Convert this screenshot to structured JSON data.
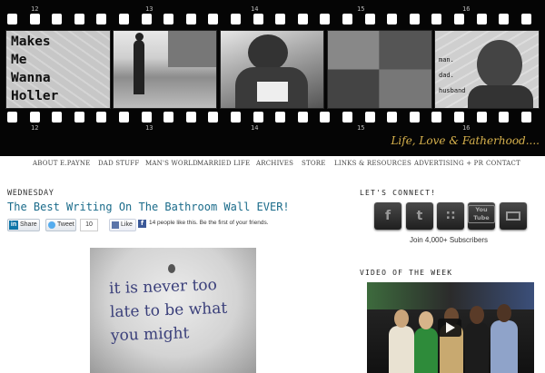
{
  "header": {
    "blog_title": "Makes\nMe\nWanna\nHoller",
    "frame_numbers": [
      "12",
      "13",
      "14",
      "15",
      "16"
    ],
    "tagline_words": [
      "man.",
      "dad.",
      "husband"
    ],
    "slogan": "Life, Love & Fatherhood...."
  },
  "nav": {
    "items": [
      "ABOUT E.PAYNE",
      "DAD STUFF",
      "MAN'S WORLD",
      "MARRIED LIFE",
      "ARCHIVES",
      "STORE",
      "LINKS & RESOURCES",
      "ADVERTISING + PR",
      "CONTACT"
    ]
  },
  "post": {
    "day": "WEDNESDAY",
    "title": "The Best Writing On The Bathroom Wall EVER!",
    "share": {
      "linkedin_icon": "in",
      "linkedin_label": "Share",
      "tweet_label": "Tweet",
      "tweet_count": "10",
      "like_label": "Like",
      "facebook_icon": "f",
      "facebook_text": "14 people like this. Be the first of your friends."
    },
    "image_text": "it is never too\nlate to be what\nyou might"
  },
  "sidebar": {
    "connect_heading": "LET'S CONNECT!",
    "social": [
      {
        "name": "facebook",
        "glyph": "f"
      },
      {
        "name": "twitter",
        "glyph": "t"
      },
      {
        "name": "rss",
        "glyph": "∷"
      },
      {
        "name": "youtube",
        "glyph": "You Tube"
      },
      {
        "name": "email",
        "glyph": ""
      }
    ],
    "subscribers": "Join 4,000+ Subscribers",
    "video_heading": "VIDEO OF THE WEEK"
  },
  "colors": {
    "header_bg": "#050505",
    "slogan": "#d9b34d",
    "title_link": "#1a6b8a"
  }
}
